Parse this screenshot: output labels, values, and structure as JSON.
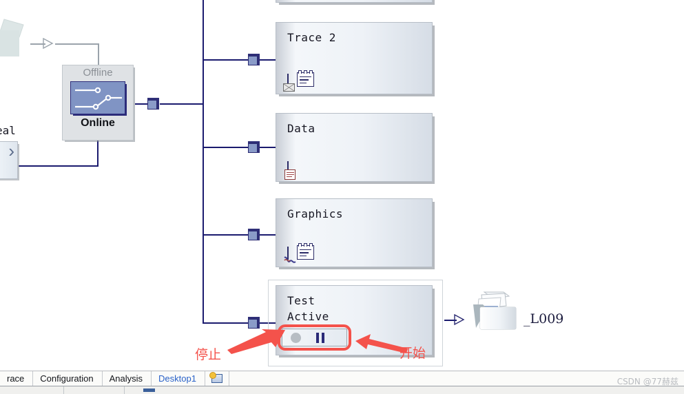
{
  "app": {
    "watermark": "CSDN @77赫兹"
  },
  "canvas": {
    "left_partial": {
      "text_label": "eal",
      "chevron": "›"
    },
    "switch_widget": {
      "name": "offline-online-switch",
      "offline_label": "Offline",
      "online_label": "Online",
      "state": "Online",
      "panel_color": "#8094c4",
      "border_color": "#2c2c7a"
    },
    "gray_folder": {
      "name": "disabled-folder-node",
      "state": "disabled"
    },
    "nodes": [
      {
        "name": "node-trace-2",
        "title": "Trace 2",
        "icons": [
          "window-envelope-icon",
          "calendar-list-icon"
        ]
      },
      {
        "name": "node-data",
        "title": "Data",
        "icons": [
          "window-document-icon"
        ]
      },
      {
        "name": "node-graphics",
        "title": "Graphics",
        "icons": [
          "window-curve-icon",
          "calendar-list-icon"
        ]
      },
      {
        "name": "node-test-active",
        "title": "Test\nActive",
        "icons": [
          "stop-pause-control"
        ],
        "selected": true
      }
    ],
    "control_bar": {
      "name": "test-run-control",
      "stop_icon": "stop-circle-icon",
      "pause_icon": "pause-bars-icon",
      "highlight_color": "#f4524b"
    },
    "report_node": {
      "name": "report-folder-node",
      "label": "_L009"
    },
    "annotations": [
      {
        "name": "annotation-stop",
        "text": "停止",
        "color": "#f4524b"
      },
      {
        "name": "annotation-start",
        "text": "开始",
        "color": "#f4524b"
      }
    ]
  },
  "tabbar": {
    "tabs": [
      {
        "label": "race",
        "active": false
      },
      {
        "label": "Configuration",
        "active": false
      },
      {
        "label": "Analysis",
        "active": false
      },
      {
        "label": "Desktop1",
        "active": true
      }
    ],
    "icon_tab": "desktop-window-icon"
  }
}
